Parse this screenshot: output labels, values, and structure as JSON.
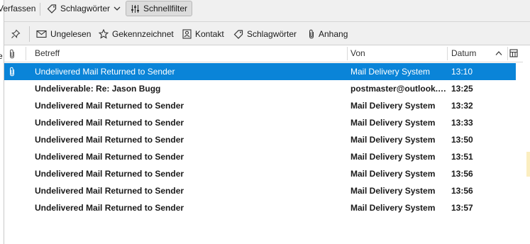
{
  "left_edge": {
    "glyph": "e"
  },
  "toolbar": {
    "compose": "Verfassen",
    "tags": "Schlagwörter",
    "quick_filter": "Schnellfilter"
  },
  "quick_filter": {
    "unread": "Ungelesen",
    "starred": "Gekennzeichnet",
    "contact": "Kontakt",
    "tags": "Schlagwörter",
    "attachment": "Anhang"
  },
  "list": {
    "columns": {
      "subject": "Betreff",
      "from": "Von",
      "date": "Datum"
    },
    "rows": [
      {
        "subject": "Undelivered Mail Returned to Sender",
        "from": "Mail Delivery System",
        "date": "13:10"
      },
      {
        "subject": "Undeliverable: Re: Jason Bugg",
        "from": "postmaster@outlook.com",
        "date": "13:25"
      },
      {
        "subject": "Undelivered Mail Returned to Sender",
        "from": "Mail Delivery System",
        "date": "13:32"
      },
      {
        "subject": "Undelivered Mail Returned to Sender",
        "from": "Mail Delivery System",
        "date": "13:33"
      },
      {
        "subject": "Undelivered Mail Returned to Sender",
        "from": "Mail Delivery System",
        "date": "13:50"
      },
      {
        "subject": "Undelivered Mail Returned to Sender",
        "from": "Mail Delivery System",
        "date": "13:51"
      },
      {
        "subject": "Undelivered Mail Returned to Sender",
        "from": "Mail Delivery System",
        "date": "13:56"
      },
      {
        "subject": "Undelivered Mail Returned to Sender",
        "from": "Mail Delivery System",
        "date": "13:56"
      },
      {
        "subject": "Undelivered Mail Returned to Sender",
        "from": "Mail Delivery System",
        "date": "13:57"
      }
    ]
  },
  "colors": {
    "selection": "#0a84d8"
  },
  "icons": {
    "tag": "tag-icon",
    "chevron": "chevron-down-icon",
    "filter": "filter-sliders-icon",
    "pin": "pin-icon",
    "unread": "envelope-icon",
    "star": "star-icon",
    "contact": "contact-card-icon",
    "attachment": "paperclip-icon",
    "sort": "sort-ascending-icon",
    "column_picker": "column-picker-icon"
  }
}
